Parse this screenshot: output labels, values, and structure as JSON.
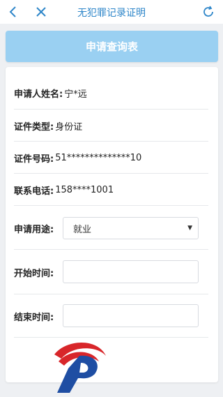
{
  "nav": {
    "title": "无犯罪记录证明",
    "back_icon": "back-chevron-icon",
    "close_icon": "close-icon",
    "refresh_icon": "refresh-icon",
    "accent_color": "#2e86c9"
  },
  "banner": {
    "label": "申请查询表",
    "color": "#9ad0f2"
  },
  "form": {
    "name_label": "申请人姓名:",
    "name_value": "宁*远",
    "id_type_label": "证件类型:",
    "id_type_value": "身份证",
    "id_number_label": "证件号码:",
    "id_number_value": "51**************10",
    "phone_label": "联系电话:",
    "phone_value": "158****1001",
    "purpose_label": "申请用途:",
    "purpose_value": "就业",
    "start_label": "开始时间:",
    "start_value": "",
    "end_label": "结束时间:",
    "end_value": ""
  },
  "logo": {
    "icon": "police-emblem-logo",
    "red": "#d8262a",
    "blue": "#1f4ea3"
  }
}
